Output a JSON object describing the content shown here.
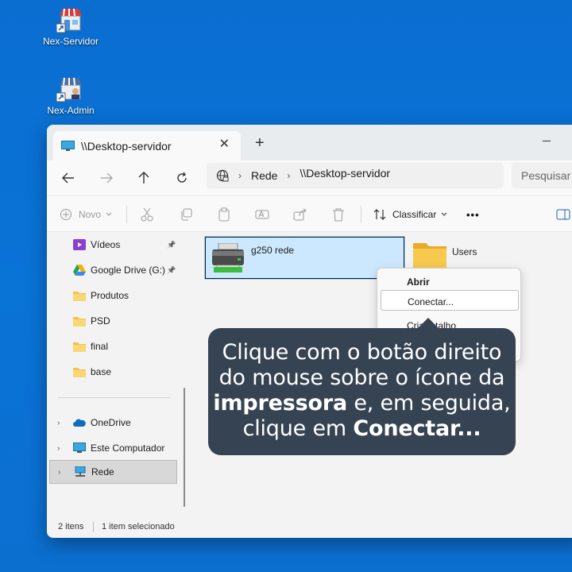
{
  "desktop": {
    "icons": [
      {
        "label": "Nex-Servidor",
        "icon": "store-shortcut-icon"
      },
      {
        "label": "Nex-Admin",
        "icon": "store-admin-shortcut-icon"
      }
    ]
  },
  "window": {
    "tab_title": "\\\\Desktop-servidor",
    "close_symbol": "✕",
    "new_tab_symbol": "+",
    "address": {
      "segments": [
        "Rede",
        "\\\\Desktop-servidor"
      ],
      "separator": "›"
    },
    "search_placeholder": "Pesquisar em",
    "toolbar": {
      "new_label": "Novo",
      "sort_label": "Classificar",
      "more_symbol": "•••"
    },
    "sidebar": {
      "items": [
        {
          "label": "Vídeos",
          "icon": "video-folder-icon",
          "pinned": true
        },
        {
          "label": "Google Drive (G:)",
          "icon": "google-drive-icon",
          "pinned": true
        },
        {
          "label": "Produtos",
          "icon": "folder-icon"
        },
        {
          "label": "PSD",
          "icon": "folder-icon"
        },
        {
          "label": "final",
          "icon": "folder-icon"
        },
        {
          "label": "base",
          "icon": "folder-icon"
        }
      ],
      "locations": [
        {
          "label": "OneDrive",
          "icon": "cloud-icon"
        },
        {
          "label": "Este Computador",
          "icon": "computer-icon"
        },
        {
          "label": "Rede",
          "icon": "network-icon",
          "selected": true
        }
      ],
      "pin_symbol": "📌",
      "expand_symbol": "›"
    },
    "content": {
      "items": [
        {
          "label": "g250 rede",
          "icon": "printer-icon",
          "selected": true
        },
        {
          "label": "Users",
          "icon": "folder-icon"
        }
      ]
    },
    "status": {
      "count": "2 itens",
      "selection": "1 item selecionado"
    }
  },
  "context_menu": {
    "items": [
      {
        "label": "Abrir",
        "bold": true
      },
      {
        "label": "Conectar...",
        "highlighted": true
      },
      {
        "label": "Criar atalho"
      }
    ]
  },
  "callout": {
    "line1": "Clique com o botão direito",
    "line2": "do mouse sobre o ícone da",
    "line3_bold": "impressora",
    "line3_rest": " e, em seguida,",
    "line4_rest": "clique em ",
    "line4_bold": "Conectar..."
  }
}
